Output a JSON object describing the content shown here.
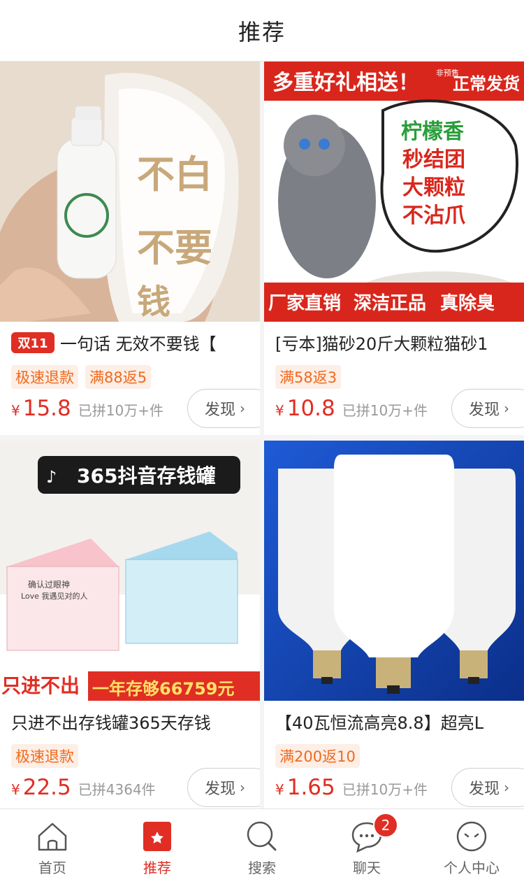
{
  "header": {
    "title": "推荐"
  },
  "products": [
    {
      "tag": "双11",
      "title": "一句话 无效不要钱【",
      "badges": [
        "极速退款",
        "满88返5"
      ],
      "currency": "¥",
      "price": "15.8",
      "sold": "已拼10万+件",
      "action": "发现",
      "image_text": [
        "不白",
        "不要",
        "钱"
      ]
    },
    {
      "tag": "",
      "title": "[亏本]猫砂20斤大颗粒猫砂1",
      "badges": [
        "满58返3"
      ],
      "currency": "¥",
      "price": "10.8",
      "sold": "已拼10万+件",
      "action": "发现",
      "image_text": [
        "多重好礼相送！",
        "非预售",
        "正常发货",
        "柠檬香",
        "秒结团",
        "大颗粒",
        "不沾爪",
        "厂家直销",
        "深洁正品",
        "真除臭"
      ]
    },
    {
      "tag": "",
      "title": "只进不出存钱罐365天存钱",
      "badges": [
        "极速退款"
      ],
      "currency": "¥",
      "price": "22.5",
      "sold": "已拼4364件",
      "action": "发现",
      "image_text": [
        "365抖音存钱罐",
        "只进不出",
        "一年存够66759元",
        "确认过眼神",
        "Love 我遇见对的人"
      ]
    },
    {
      "tag": "",
      "title": "【40瓦恒流高亮8.8】超亮L",
      "badges": [
        "满200返10"
      ],
      "currency": "¥",
      "price": "1.65",
      "sold": "已拼10万+件",
      "action": "发现",
      "image_text": []
    }
  ],
  "tabbar": {
    "items": [
      {
        "label": "首页",
        "icon": "home-icon"
      },
      {
        "label": "推荐",
        "icon": "recommend-icon"
      },
      {
        "label": "搜索",
        "icon": "search-icon"
      },
      {
        "label": "聊天",
        "icon": "chat-icon",
        "badge": "2"
      },
      {
        "label": "个人中心",
        "icon": "profile-icon"
      }
    ]
  },
  "colors": {
    "accent": "#e02e24",
    "badge_text": "#f06a1d",
    "badge_bg": "#fdeee6"
  }
}
